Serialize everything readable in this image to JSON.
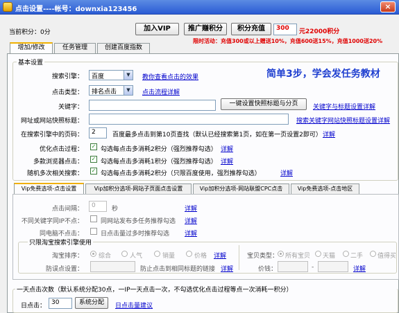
{
  "window": {
    "title": "点击设置----帐号：downxia123456",
    "close_label": "×"
  },
  "topbar": {
    "points_label": "当前积分：0分",
    "join_vip": "加入VIP",
    "promote_earn": "推广赚积分",
    "recharge": "积分充值",
    "amount_value": "300",
    "amount_text": "元22000积分",
    "promo_text": "限时活动：充值300或以上赠送10%，充值600送15%，充值1000送20%"
  },
  "tabs": [
    "增加/修改",
    "任务管理",
    "创建百度指数"
  ],
  "basic": {
    "group_label": "基本设置",
    "headline": "简单3步，学会发任务教材",
    "engine_label": "搜索引擎：",
    "engine_value": "百度",
    "engine_link": "教你查看点击的效果",
    "type_label": "点击类型：",
    "type_value": "排名点击",
    "type_link": "点击流程详解",
    "keyword_label": "关键字：",
    "keyword_btn": "一键设置快照标题与分页",
    "keyword_link": "关键字与标题设置详解",
    "url_label": "网址或网站快照标题：",
    "url_link": "搜索关键字网站快照标题设置详解",
    "page_label": "在搜索引擎中的页码：",
    "page_value": "2",
    "page_note": "百度最多点击到第10页查找（默认已经搜索第1页，如在第一页设置2即可）",
    "page_link": "详解",
    "opt1_label": "优化点击过程：",
    "opt1_text": "勾选每点击多消耗2积分（强烈推荐勾选）",
    "opt2_label": "多款浏览器点击：",
    "opt2_text": "勾选每点击多消耗1积分（强烈推荐勾选）",
    "opt3_label": "随机多次相关搜索：",
    "opt3_text": "勾选每点击多消耗2积分（只限百度使用，强烈推荐勾选）",
    "detail_link": "详解",
    "check_mark": "✓"
  },
  "vip_tabs": [
    "Vip免费选项-点击设置",
    "Vip加积分选项-网站子页面点击设置",
    "Vip加积分选项-网站联盟CPC点击",
    "Vip免费选项-点击地区"
  ],
  "vip": {
    "interval_label": "点击间隔：",
    "interval_value": "0",
    "interval_unit": "秒",
    "interval_link": "详解",
    "diff_ip_label": "不同关键字同IP不点：",
    "diff_ip_text": "同网站发布多任务推荐勾选",
    "diff_ip_link": "详解",
    "same_pc_label": "同电脑不点击：",
    "same_pc_text": "日点击量过多时推荐勾选",
    "same_pc_link": "详解",
    "taobao_group": "只限淘宝搜索引擎使用",
    "sort_label": "淘宝排序：",
    "sort_options": [
      "综合",
      "人气",
      "销量",
      "价格"
    ],
    "sort_link": "详解",
    "shop_type_label": "宝贝类型：",
    "shop_type_options": [
      "所有宝贝",
      "天猫",
      "二手",
      "值得买"
    ],
    "anti_label": "防误点设置：",
    "anti_text": "防止点击到相同标题的链接",
    "anti_link": "详解",
    "price_label": "价钱：",
    "price_sep": "-",
    "price_link": "详解"
  },
  "daily": {
    "group_label": "一天点击次数（默认系统分配30点，一IP一天点击一次，不勾选优化点击过程等点一次消耗一积分）",
    "clicks_label": "日点击：",
    "clicks_value": "30",
    "allocate_btn": "系统分配",
    "suggest_link": "日点击量建议"
  }
}
